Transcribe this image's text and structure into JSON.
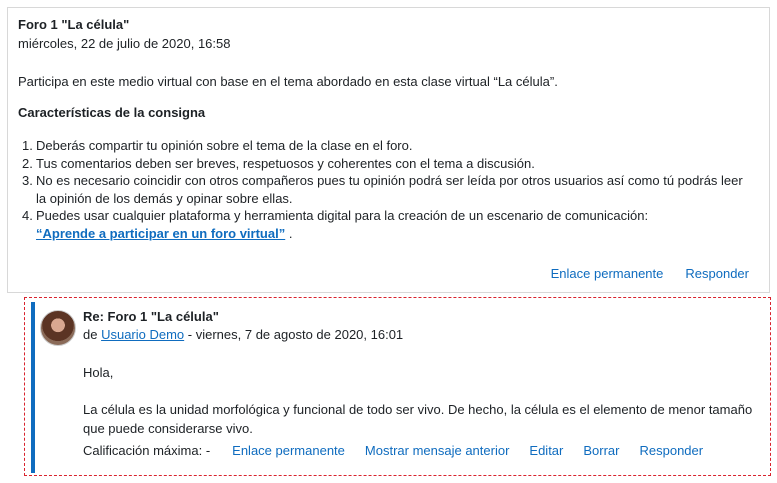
{
  "post": {
    "title": "Foro 1 \"La célula\"",
    "date": "miércoles, 22 de julio de 2020, 16:58",
    "intro": "Participa en este medio virtual con base en el tema abordado en esta clase virtual “La célula”.",
    "heading": "Características de la consigna",
    "items": [
      {
        "num": "1.",
        "text": "Deberás compartir tu opinión sobre el tema de la clase en el foro."
      },
      {
        "num": "2.",
        "text": "Tus comentarios deben ser breves, respetuosos y coherentes con el tema a discusión."
      },
      {
        "num": "3.",
        "text": "No es necesario coincidir con otros compañeros pues tu opinión podrá ser leída por otros usuarios así como tú podrás leer la opinión de los demás y opinar sobre ellas."
      },
      {
        "num": "4.",
        "text": "Puedes usar cualquier plataforma y herramienta digital para la creación de un escenario de comunicación:",
        "link": "“Aprende a participar en un foro virtual”",
        "suffix": " ."
      }
    ],
    "actions": {
      "permalink": "Enlace permanente",
      "reply": "Responder"
    }
  },
  "reply": {
    "title": "Re: Foro 1 \"La célula\"",
    "by_prefix": "de ",
    "author": "Usuario Demo",
    "date_suffix": " - viernes, 7 de agosto de 2020, 16:01",
    "greeting": "Hola,",
    "body": "La célula es la unidad morfológica y funcional de todo ser vivo. De hecho, la célula es el elemento de menor tamaño que puede considerarse vivo.",
    "grade": "Calificación máxima: -",
    "actions": {
      "permalink": "Enlace permanente",
      "show_parent": "Mostrar mensaje anterior",
      "edit": "Editar",
      "delete": "Borrar",
      "reply": "Responder"
    }
  },
  "colors": {
    "link": "#0f6cbf",
    "highlight_border": "#d9232e"
  }
}
